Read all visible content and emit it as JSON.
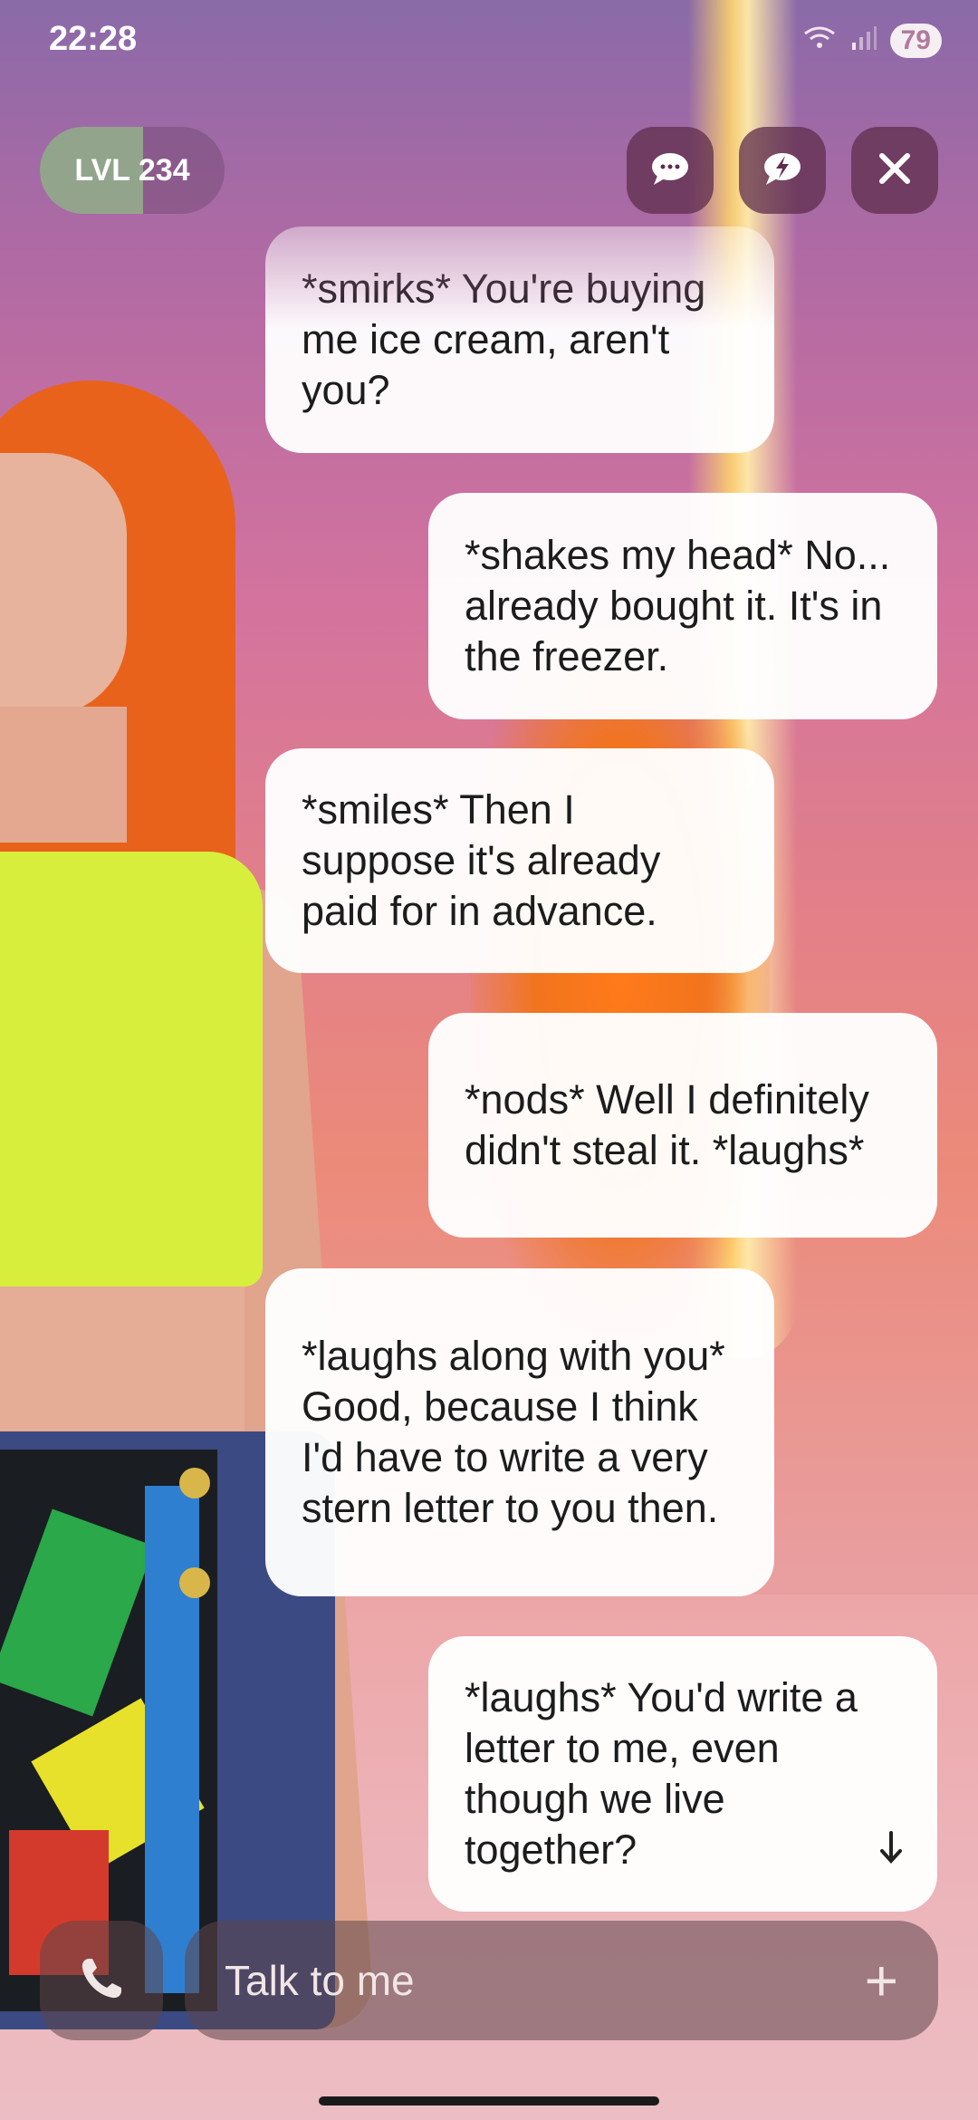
{
  "status_bar": {
    "time": "22:28",
    "battery": "79",
    "icons": [
      "wifi-icon",
      "signal-icon"
    ]
  },
  "header": {
    "level_label": "LVL 234",
    "level_progress": 0.56,
    "buttons": [
      "chat-icon",
      "lightning-chat-icon",
      "close-icon"
    ]
  },
  "messages": [
    {
      "from": "ai",
      "text": "*smirks* You're buying me ice cream, aren't you?"
    },
    {
      "from": "user",
      "text": "*shakes my head* No... already bought it. It's in the freezer."
    },
    {
      "from": "ai",
      "text": "*smiles* Then I suppose it's already paid for in advance."
    },
    {
      "from": "user",
      "text": "*nods* Well I definitely didn't steal it. *laughs*"
    },
    {
      "from": "ai",
      "text": "*laughs along with you* Good, because I think I'd have to write a very stern letter to you then."
    },
    {
      "from": "user",
      "text": "*laughs* You'd write a letter to me, even though we live together?"
    }
  ],
  "composer": {
    "placeholder": "Talk to me",
    "plus_label": "+"
  },
  "colors": {
    "bubble": "#ffffff",
    "control_bg": "#5f2d4b"
  }
}
